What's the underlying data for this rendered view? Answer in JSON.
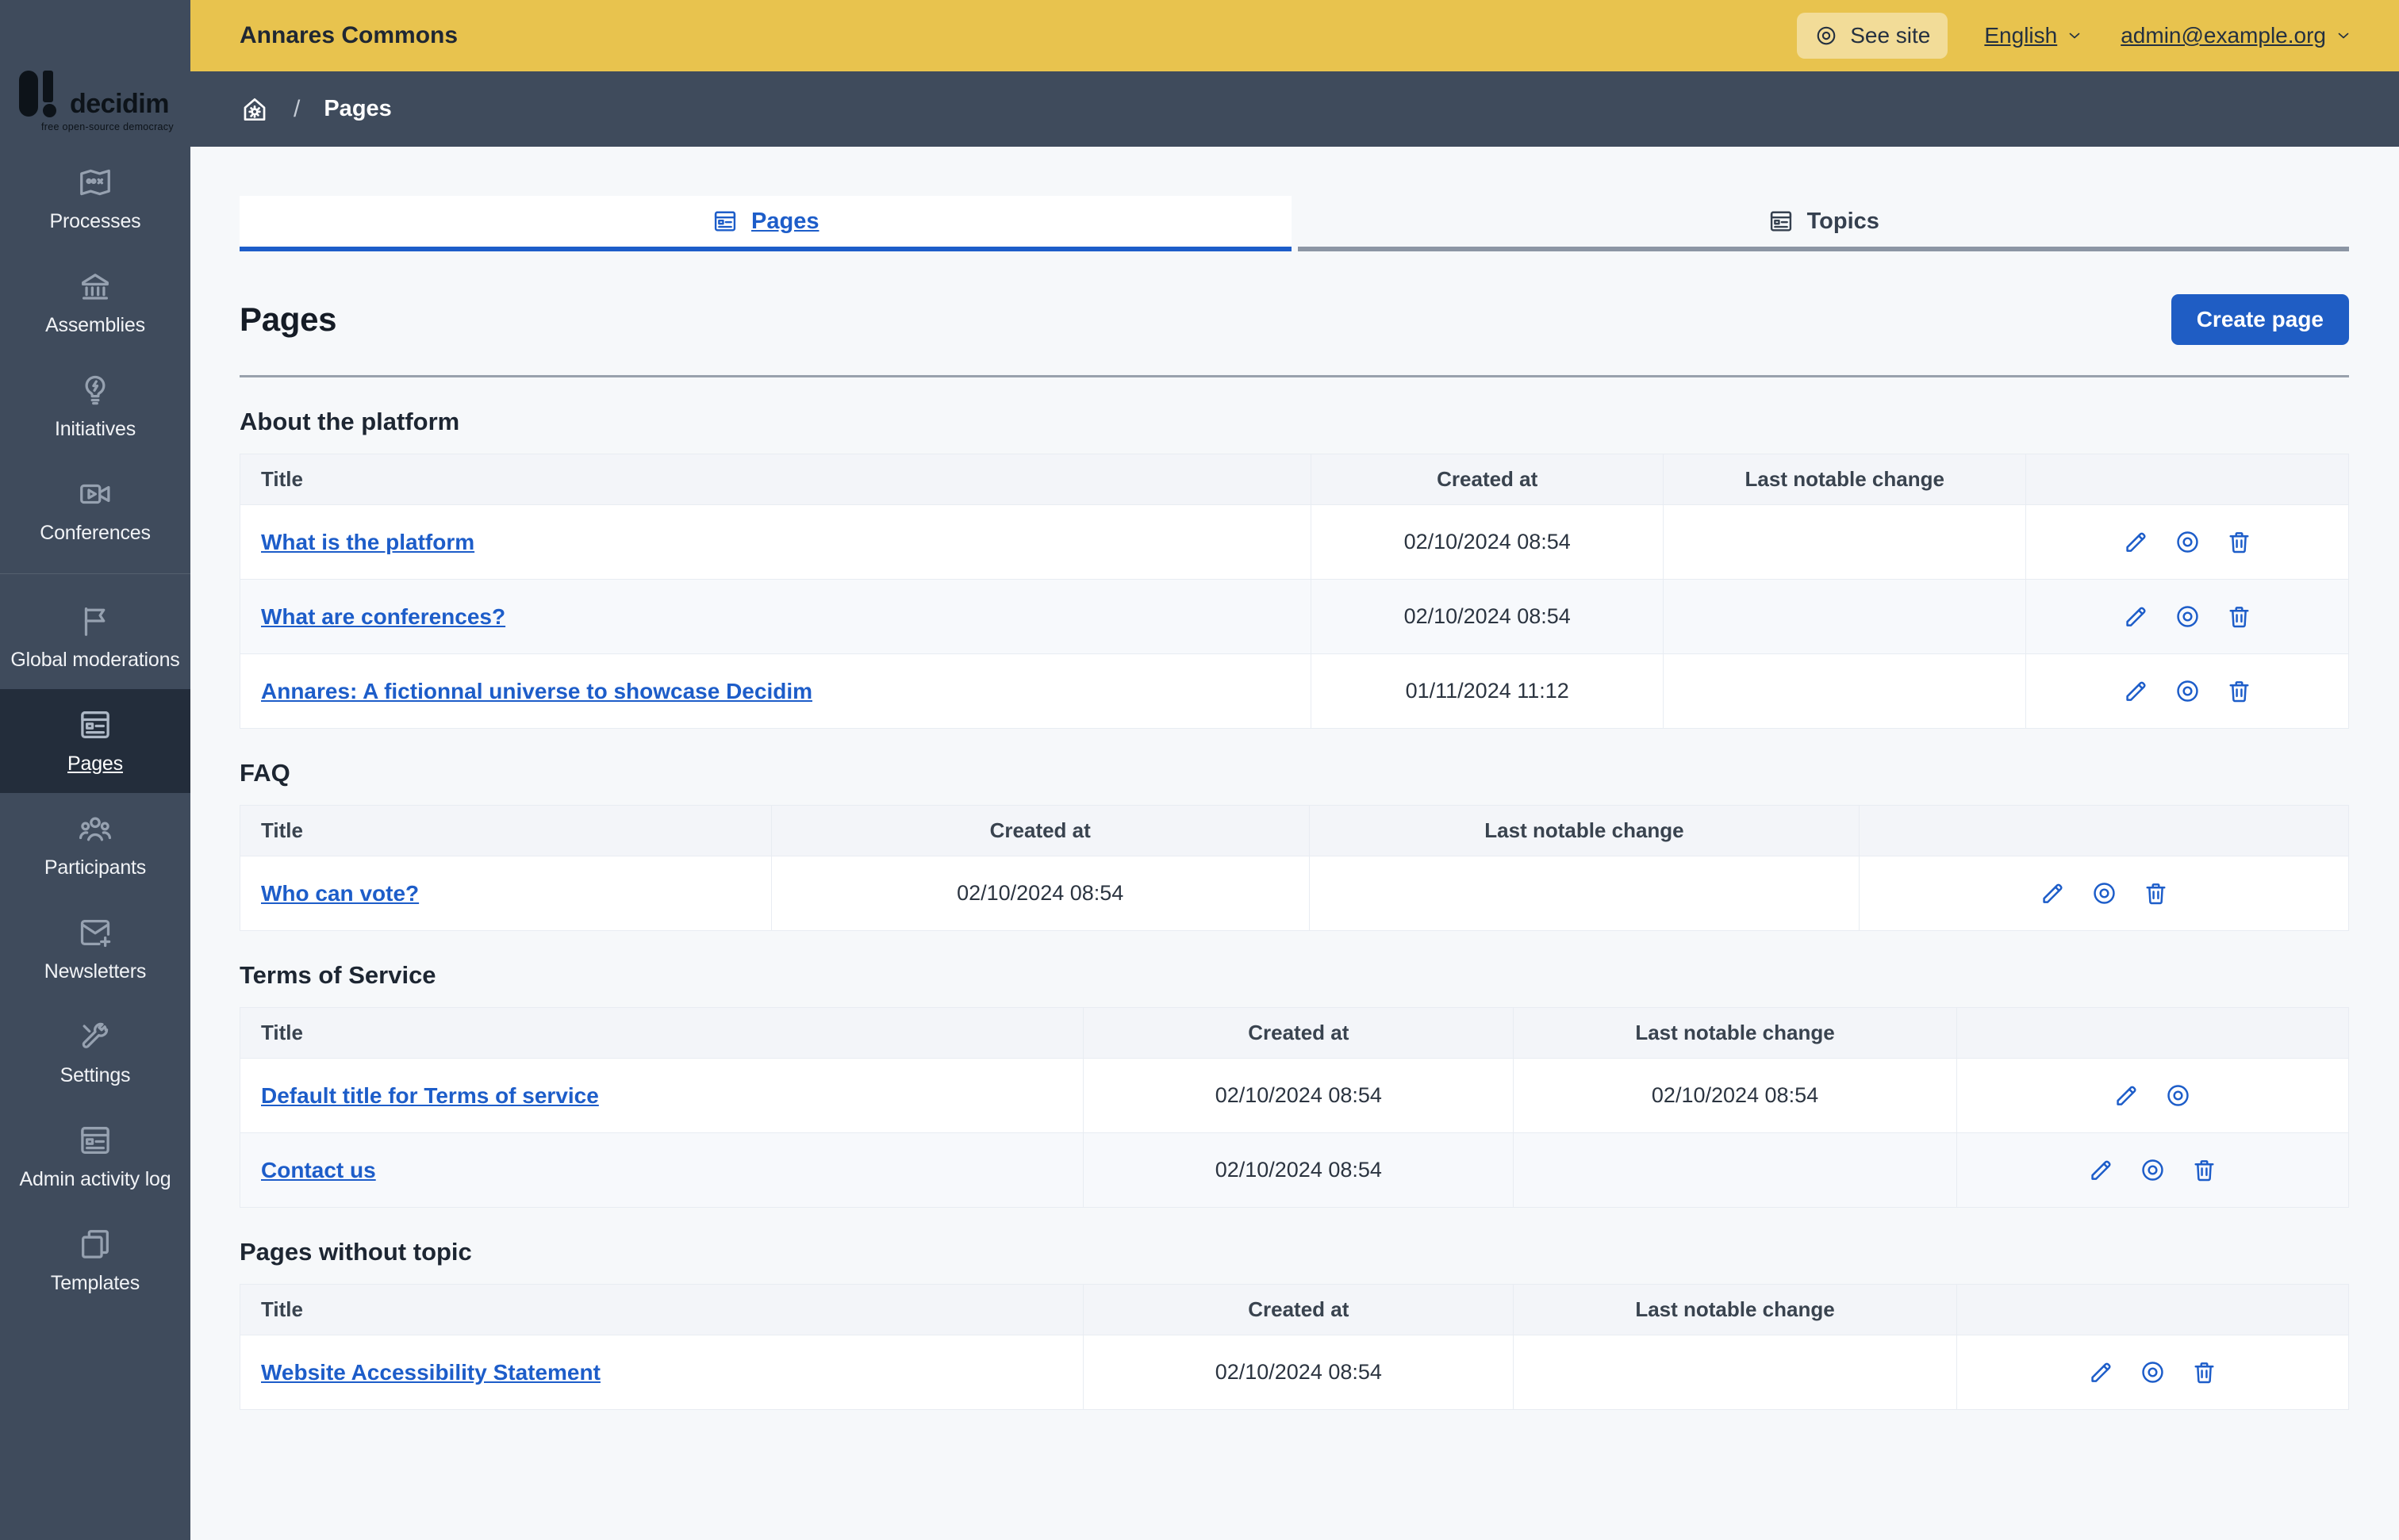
{
  "logo": {
    "brand": "decidim",
    "tagline": "free open-source democracy"
  },
  "topbar": {
    "org_name": "Annares Commons",
    "see_site_label": "See site",
    "language_label": "English",
    "account_label": "admin@example.org"
  },
  "breadcrumb": {
    "separator": "/",
    "current": "Pages"
  },
  "sidebar": {
    "items": [
      {
        "label": "Processes",
        "icon": "map-icon",
        "active": false
      },
      {
        "label": "Assemblies",
        "icon": "bank-icon",
        "active": false
      },
      {
        "label": "Initiatives",
        "icon": "lightbulb-flash-icon",
        "active": false
      },
      {
        "label": "Conferences",
        "icon": "video-icon",
        "active": false
      },
      {
        "label": "Global moderations",
        "icon": "flag-icon",
        "active": false
      },
      {
        "label": "Pages",
        "icon": "pages-icon",
        "active": true
      },
      {
        "label": "Participants",
        "icon": "group-icon",
        "active": false
      },
      {
        "label": "Newsletters",
        "icon": "mail-add-icon",
        "active": false
      },
      {
        "label": "Settings",
        "icon": "tools-icon",
        "active": false
      },
      {
        "label": "Admin activity log",
        "icon": "activity-log-icon",
        "active": false
      },
      {
        "label": "Templates",
        "icon": "copy-icon",
        "active": false
      }
    ]
  },
  "tabs": [
    {
      "label": "Pages",
      "active": true
    },
    {
      "label": "Topics",
      "active": false
    }
  ],
  "page": {
    "title": "Pages",
    "create_button": "Create page"
  },
  "columns": {
    "title": "Title",
    "created_at": "Created at",
    "last_change": "Last notable change"
  },
  "sections": [
    {
      "heading": "About the platform",
      "rows": [
        {
          "title": "What is the platform",
          "created_at": "02/10/2024 08:54",
          "last_change": "",
          "actions": [
            "edit",
            "preview",
            "delete"
          ]
        },
        {
          "title": "What are conferences?",
          "created_at": "02/10/2024 08:54",
          "last_change": "",
          "actions": [
            "edit",
            "preview",
            "delete"
          ]
        },
        {
          "title": "Annares: A fictionnal universe to showcase Decidim",
          "created_at": "01/11/2024 11:12",
          "last_change": "",
          "actions": [
            "edit",
            "preview",
            "delete"
          ]
        }
      ]
    },
    {
      "heading": "FAQ",
      "rows": [
        {
          "title": "Who can vote?",
          "created_at": "02/10/2024 08:54",
          "last_change": "",
          "actions": [
            "edit",
            "preview",
            "delete"
          ]
        }
      ]
    },
    {
      "heading": "Terms of Service",
      "rows": [
        {
          "title": "Default title for Terms of service",
          "created_at": "02/10/2024 08:54",
          "last_change": "02/10/2024 08:54",
          "actions": [
            "edit",
            "preview"
          ]
        },
        {
          "title": "Contact us",
          "created_at": "02/10/2024 08:54",
          "last_change": "",
          "actions": [
            "edit",
            "preview",
            "delete"
          ]
        }
      ]
    },
    {
      "heading": "Pages without topic",
      "rows": [
        {
          "title": "Website Accessibility Statement",
          "created_at": "02/10/2024 08:54",
          "last_change": "",
          "actions": [
            "edit",
            "preview",
            "delete"
          ]
        }
      ]
    }
  ],
  "colors": {
    "accent_blue": "#1D5DC9",
    "topbar_yellow": "#E8C34E",
    "sidebar_slate": "#3F4B5C",
    "sidebar_active": "#232D3B",
    "main_background": "#F6F8FA"
  }
}
